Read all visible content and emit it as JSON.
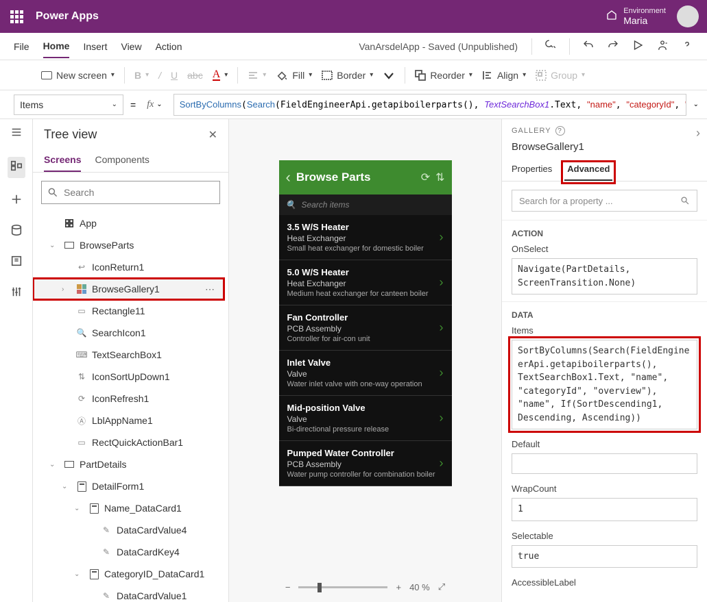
{
  "header": {
    "product": "Power Apps",
    "env_label": "Environment",
    "env_name": "Maria"
  },
  "menubar": {
    "file": "File",
    "home": "Home",
    "insert": "Insert",
    "view": "View",
    "action": "Action",
    "doctitle": "VanArsdelApp - Saved (Unpublished)"
  },
  "ribbon": {
    "newscreen": "New screen",
    "fill": "Fill",
    "border": "Border",
    "reorder": "Reorder",
    "align": "Align",
    "group": "Group"
  },
  "formula": {
    "property": "Items",
    "text_plain": "SortByColumns(Search(FieldEngineerApi.getapiboilerparts(), TextSearchBox1.Text, \"name\", \"categoryId\", \"overview\"), \"name\", If(SortDescending1, Descending"
  },
  "tree": {
    "title": "Tree view",
    "tab_screens": "Screens",
    "tab_components": "Components",
    "search_placeholder": "Search",
    "nodes": {
      "app": "App",
      "browseparts": "BrowseParts",
      "iconreturn1": "IconReturn1",
      "browsegallery1": "BrowseGallery1",
      "rectangle11": "Rectangle11",
      "searchicon1": "SearchIcon1",
      "textsearchbox1": "TextSearchBox1",
      "iconsortupdown1": "IconSortUpDown1",
      "iconrefresh1": "IconRefresh1",
      "lblappname1": "LblAppName1",
      "rectquickactionbar1": "RectQuickActionBar1",
      "partdetails": "PartDetails",
      "detailform1": "DetailForm1",
      "name_datacard1": "Name_DataCard1",
      "datacardvalue4": "DataCardValue4",
      "datacardkey4": "DataCardKey4",
      "categoryid_datacard1": "CategoryID_DataCard1",
      "datacardvalue1": "DataCardValue1"
    }
  },
  "phone": {
    "title": "Browse Parts",
    "search_placeholder": "Search items",
    "items": [
      {
        "name": "3.5 W/S Heater",
        "cat": "Heat Exchanger",
        "desc": "Small heat exchanger for domestic boiler"
      },
      {
        "name": "5.0 W/S Heater",
        "cat": "Heat Exchanger",
        "desc": "Medium heat exchanger for canteen boiler"
      },
      {
        "name": "Fan Controller",
        "cat": "PCB Assembly",
        "desc": "Controller for air-con unit"
      },
      {
        "name": "Inlet Valve",
        "cat": "Valve",
        "desc": "Water inlet valve with one-way operation"
      },
      {
        "name": "Mid-position Valve",
        "cat": "Valve",
        "desc": "Bi-directional pressure release"
      },
      {
        "name": "Pumped Water Controller",
        "cat": "PCB Assembly",
        "desc": "Water pump controller for combination boiler"
      }
    ]
  },
  "canvas_footer": {
    "zoom": "40 %"
  },
  "rightpanel": {
    "type": "GALLERY",
    "name": "BrowseGallery1",
    "tab_props": "Properties",
    "tab_adv": "Advanced",
    "search_placeholder": "Search for a property ...",
    "section_action": "ACTION",
    "onselect_label": "OnSelect",
    "onselect_value": "Navigate(PartDetails, ScreenTransition.None)",
    "section_data": "DATA",
    "items_label": "Items",
    "items_value": "SortByColumns(Search(FieldEngineerApi.getapiboilerparts(), TextSearchBox1.Text, \"name\", \"categoryId\", \"overview\"), \"name\", If(SortDescending1, Descending, Ascending))",
    "default_label": "Default",
    "default_value": "",
    "wrapcount_label": "WrapCount",
    "wrapcount_value": "1",
    "selectable_label": "Selectable",
    "selectable_value": "true",
    "accessiblelabel_label": "AccessibleLabel"
  },
  "chart_data": null
}
